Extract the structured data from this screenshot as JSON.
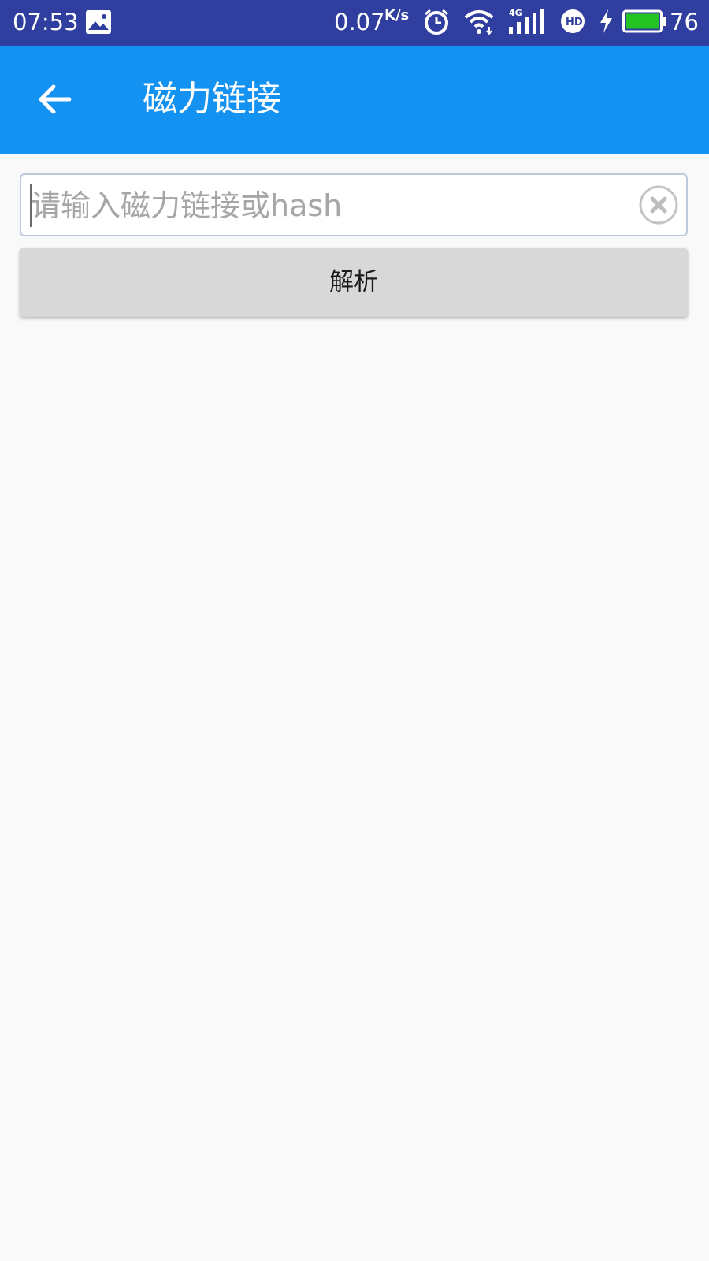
{
  "status_bar": {
    "time": "07:53",
    "network_speed": "0.07",
    "network_speed_unit": "K/s",
    "signal_type": "4G",
    "hd_badge": "HD",
    "battery_level": "76",
    "icons": [
      "gallery-icon",
      "alarm-icon",
      "wifi-icon",
      "signal-icon",
      "hd-icon",
      "charging-icon",
      "battery-icon"
    ]
  },
  "app_bar": {
    "title": "磁力链接",
    "back_icon": "arrow-left-icon",
    "background": "#1492f2"
  },
  "search": {
    "placeholder": "请输入磁力链接或hash",
    "value": "",
    "clear_icon": "clear-circle-icon"
  },
  "parse_button": {
    "label": "解析"
  },
  "colors": {
    "status_bar": "#303f9f",
    "app_bar": "#1492f2",
    "page_background": "#f9f9f9",
    "button_background": "#d8d8d8",
    "battery_fill": "#22c322"
  }
}
